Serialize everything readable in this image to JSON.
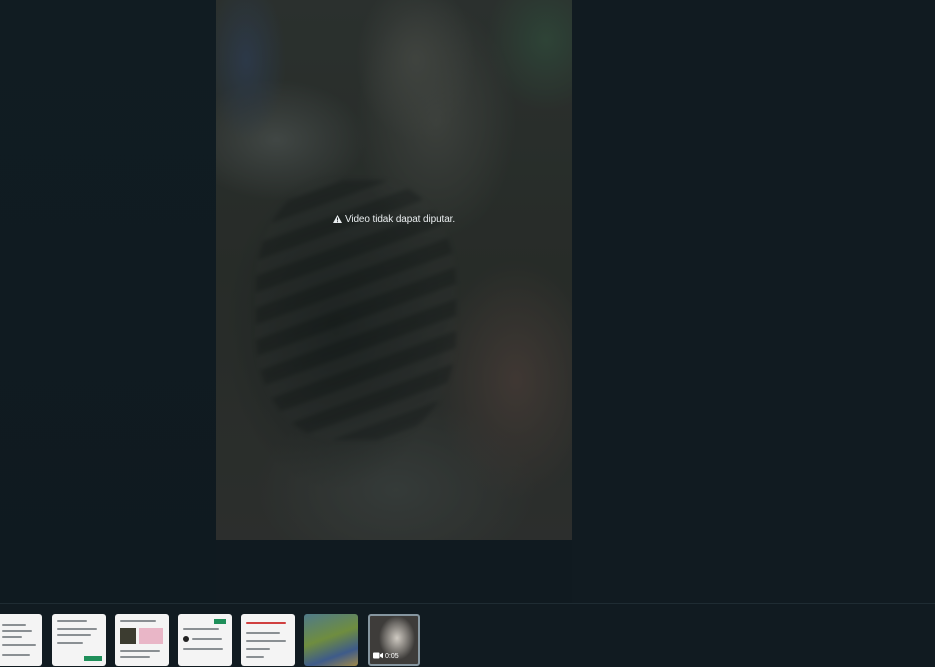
{
  "viewer": {
    "error_text": "Video tidak dapat diputar."
  },
  "thumbnails": [
    {
      "kind": "document"
    },
    {
      "kind": "document"
    },
    {
      "kind": "document"
    },
    {
      "kind": "document"
    },
    {
      "kind": "document"
    },
    {
      "kind": "photo"
    },
    {
      "kind": "video",
      "duration": "0:05",
      "selected": true
    }
  ],
  "colors": {
    "background": "#111b21",
    "text": "#e9edef",
    "selected_border": "#8696a0",
    "accent_green": "#1f8f5a"
  },
  "icons": {
    "error": "warning-icon",
    "video_badge": "video-camera-icon"
  }
}
